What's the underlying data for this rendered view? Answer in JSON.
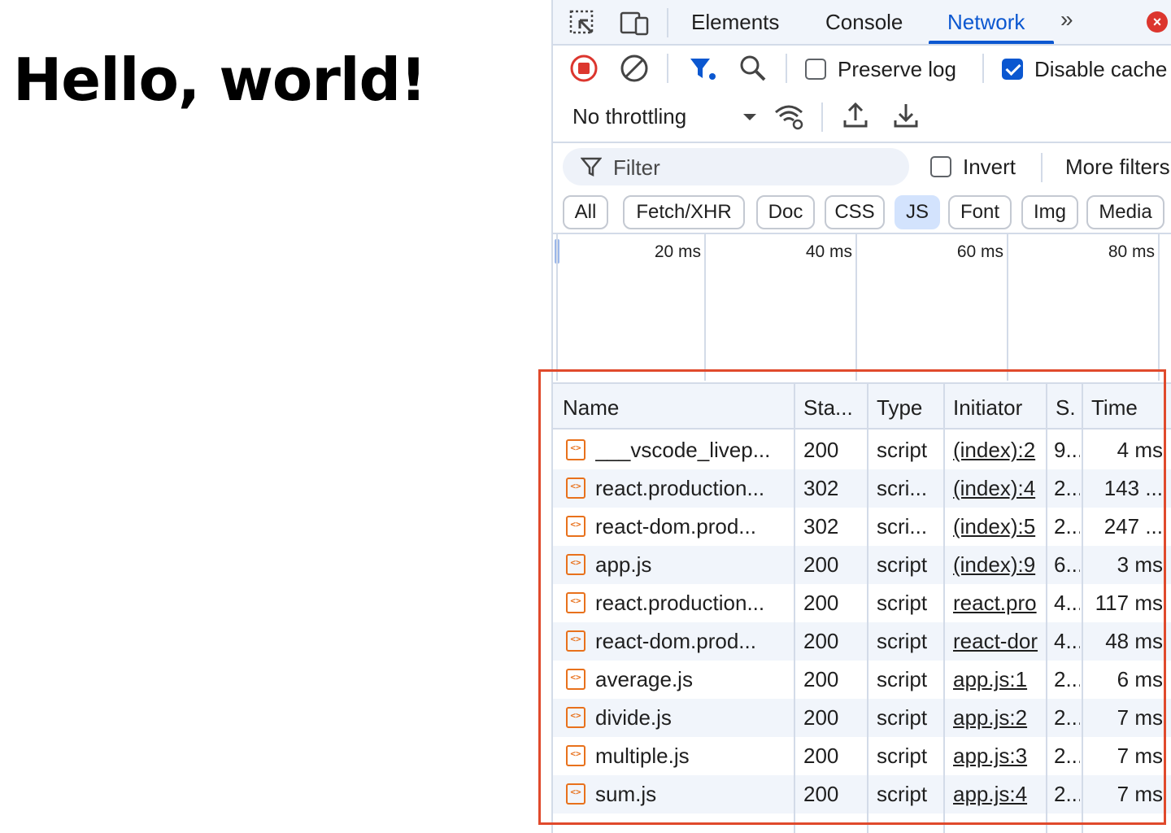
{
  "page": {
    "heading": "Hello, world!"
  },
  "devtools": {
    "tabs": [
      {
        "label": "Elements"
      },
      {
        "label": "Console"
      },
      {
        "label": "Network"
      }
    ],
    "toolbar": {
      "preserve_log_label": "Preserve log",
      "preserve_log_checked": false,
      "disable_cache_label": "Disable cache",
      "disable_cache_checked": true,
      "throttling_value": "No throttling"
    },
    "filter": {
      "placeholder": "Filter",
      "invert_label": "Invert",
      "more_filters_label": "More filters",
      "invert_checked": false,
      "types": [
        "All",
        "Fetch/XHR",
        "Doc",
        "CSS",
        "JS",
        "Font",
        "Img",
        "Media"
      ],
      "active_type": "JS"
    },
    "overview": {
      "ticks": [
        "20 ms",
        "40 ms",
        "60 ms",
        "80 ms"
      ]
    },
    "table": {
      "columns": [
        "Name",
        "Sta...",
        "Type",
        "Initiator",
        "S.",
        "Time"
      ],
      "rows": [
        {
          "name": "___vscode_livep...",
          "status": "200",
          "type": "script",
          "initiator": "(index):2",
          "size": "9...",
          "time": "4 ms"
        },
        {
          "name": "react.production...",
          "status": "302",
          "type": "scri...",
          "initiator": "(index):4",
          "size": "2...",
          "time": "143 ..."
        },
        {
          "name": "react-dom.prod...",
          "status": "302",
          "type": "scri...",
          "initiator": "(index):5",
          "size": "2...",
          "time": "247 ..."
        },
        {
          "name": "app.js",
          "status": "200",
          "type": "script",
          "initiator": "(index):9",
          "size": "6...",
          "time": "3 ms"
        },
        {
          "name": "react.production...",
          "status": "200",
          "type": "script",
          "initiator": "react.pro",
          "size": "4...",
          "time": "117 ms"
        },
        {
          "name": "react-dom.prod...",
          "status": "200",
          "type": "script",
          "initiator": "react-dor",
          "size": "4...",
          "time": "48 ms"
        },
        {
          "name": "average.js",
          "status": "200",
          "type": "script",
          "initiator": "app.js:1",
          "size": "2...",
          "time": "6 ms"
        },
        {
          "name": "divide.js",
          "status": "200",
          "type": "script",
          "initiator": "app.js:2",
          "size": "2...",
          "time": "7 ms"
        },
        {
          "name": "multiple.js",
          "status": "200",
          "type": "script",
          "initiator": "app.js:3",
          "size": "2...",
          "time": "7 ms"
        },
        {
          "name": "sum.js",
          "status": "200",
          "type": "script",
          "initiator": "app.js:4",
          "size": "2...",
          "time": "7 ms"
        }
      ]
    }
  },
  "colors": {
    "accent": "#0b57d0",
    "highlight": "#e04a2c",
    "js_icon": "#e8711c",
    "record": "#dc362e"
  }
}
